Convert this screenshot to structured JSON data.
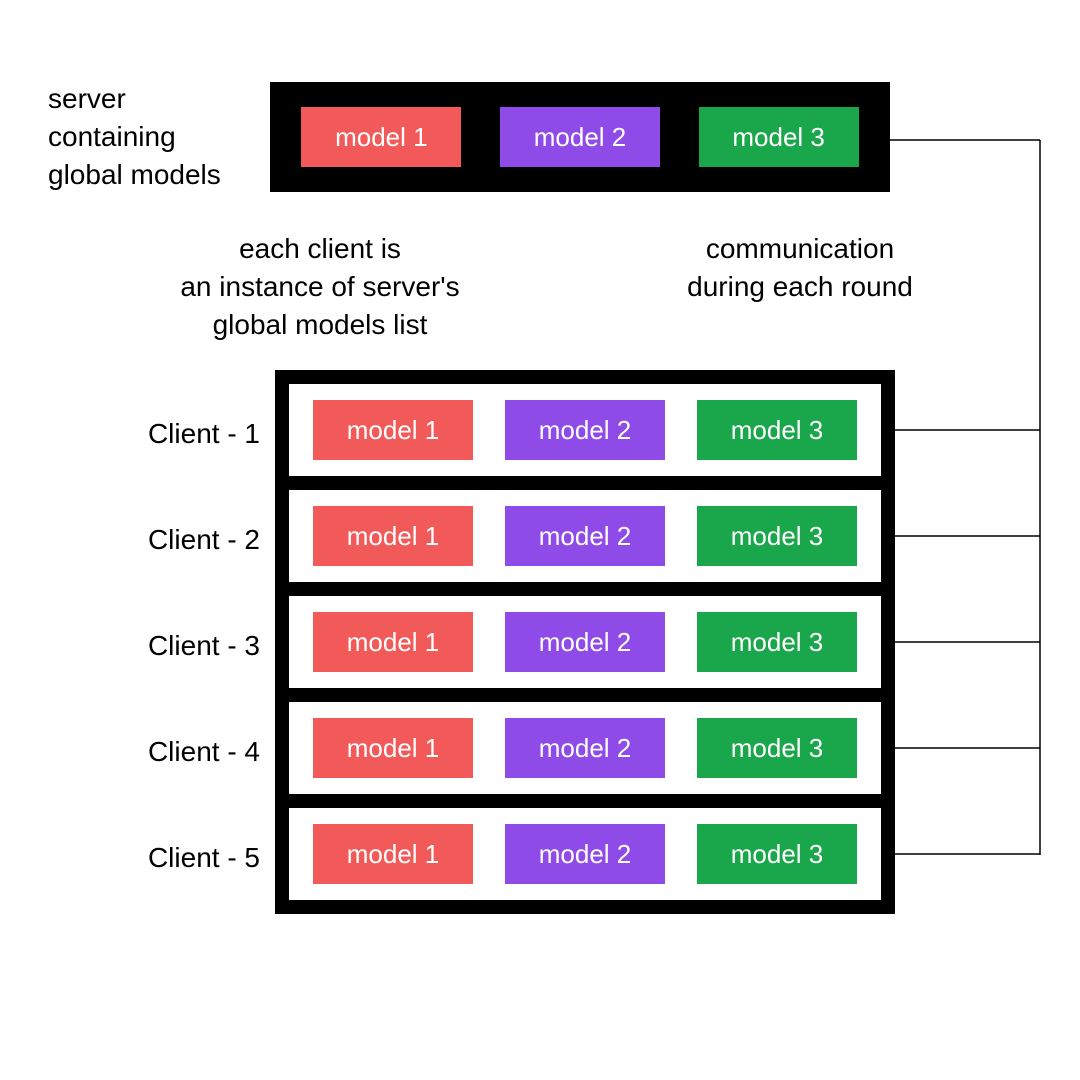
{
  "server_label": "server\ncontaining\nglobal models",
  "client_instances_label": "each client is\nan instance of server's\nglobal models list",
  "communication_label": "communication\nduring each round",
  "models": [
    {
      "name": "model 1",
      "color": "m1"
    },
    {
      "name": "model 2",
      "color": "m2"
    },
    {
      "name": "model 3",
      "color": "m3"
    }
  ],
  "clients": [
    {
      "label": "Client - 1"
    },
    {
      "label": "Client - 2"
    },
    {
      "label": "Client - 3"
    },
    {
      "label": "Client - 4"
    },
    {
      "label": "Client - 5"
    }
  ]
}
